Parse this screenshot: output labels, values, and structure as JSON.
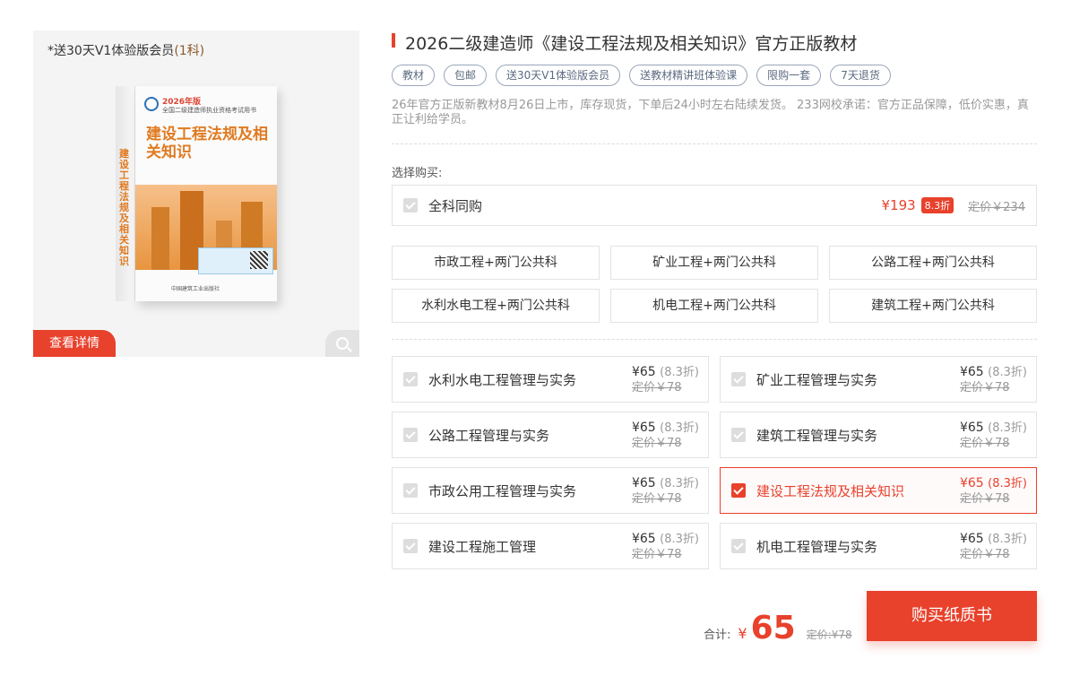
{
  "image": {
    "promo_note_prefix": "*送30天V1体验版会员",
    "promo_note_highlight": "(1科)",
    "book": {
      "year": "2026年版",
      "series": "全国二级建造师执业资格考试用书",
      "title": "建设工程法规及相关知识",
      "spine": "建设工程法规及相关知识",
      "publisher": "中国建筑工业出版社"
    },
    "detail_label": "查看详情",
    "zoom_icon": "search-icon"
  },
  "product": {
    "title": "2026二级建造师《建设工程法规及相关知识》官方正版教材",
    "tags": [
      "教材",
      "包邮",
      "送30天V1体验版会员",
      "送教材精讲班体验课",
      "限购一套",
      "7天退货"
    ],
    "description": "26年官方正版新教材8月26日上市，库存现货，下单后24小时左右陆续发货。 233网校承诺：官方正品保障，低价实惠，真正让利给学员。"
  },
  "purchase": {
    "choose_label": "选择购买:",
    "all_subjects": {
      "label": "全科同购",
      "price": "¥193",
      "discount": "8.3折",
      "original": "定价￥234"
    },
    "combos": [
      "市政工程+两门公共科",
      "矿业工程+两门公共科",
      "公路工程+两门公共科",
      "水利水电工程+两门公共科",
      "机电工程+两门公共科",
      "建筑工程+两门公共科"
    ],
    "subjects": [
      {
        "name": "水利水电工程管理与实务",
        "price": "¥65",
        "discount": "(8.3折)",
        "original": "定价￥78",
        "selected": false
      },
      {
        "name": "矿业工程管理与实务",
        "price": "¥65",
        "discount": "(8.3折)",
        "original": "定价￥78",
        "selected": false
      },
      {
        "name": "公路工程管理与实务",
        "price": "¥65",
        "discount": "(8.3折)",
        "original": "定价￥78",
        "selected": false
      },
      {
        "name": "建筑工程管理与实务",
        "price": "¥65",
        "discount": "(8.3折)",
        "original": "定价￥78",
        "selected": false
      },
      {
        "name": "市政公用工程管理与实务",
        "price": "¥65",
        "discount": "(8.3折)",
        "original": "定价￥78",
        "selected": false
      },
      {
        "name": "建设工程法规及相关知识",
        "price": "¥65",
        "discount": "(8.3折)",
        "original": "定价￥78",
        "selected": true
      },
      {
        "name": "建设工程施工管理",
        "price": "¥65",
        "discount": "(8.3折)",
        "original": "定价￥78",
        "selected": false
      },
      {
        "name": "机电工程管理与实务",
        "price": "¥65",
        "discount": "(8.3折)",
        "original": "定价￥78",
        "selected": false
      }
    ],
    "total": {
      "label": "合计:",
      "currency": "¥",
      "amount": "65",
      "original": "定价:¥78"
    },
    "buy_label": "购买纸质书"
  },
  "colors": {
    "accent": "#e8412c",
    "tag_border": "#9aa6b8"
  }
}
